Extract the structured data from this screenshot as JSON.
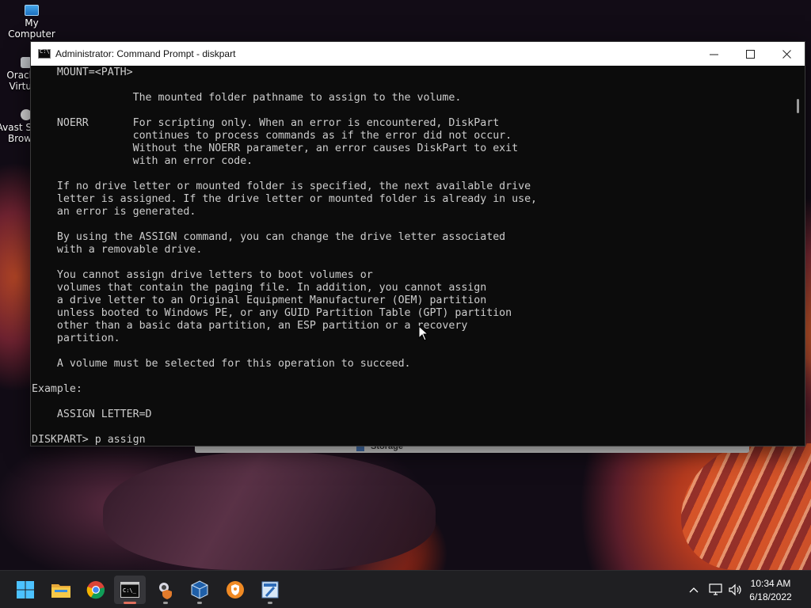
{
  "desktop": {
    "icons": [
      {
        "label": "My Computer",
        "icon": "monitor-icon"
      },
      {
        "label": "Oracl\nVirtu",
        "icon": "virtualbox-icon"
      },
      {
        "label": "Avast S\nBrow",
        "icon": "avast-browser-icon"
      }
    ],
    "behind_window_label": "Storage"
  },
  "window": {
    "title": "Administrator: Command Prompt - diskpart",
    "controls": {
      "minimize": "minimize-icon",
      "maximize": "maximize-icon",
      "close": "close-icon"
    }
  },
  "console": {
    "lines": [
      "    MOUNT=<PATH>",
      "",
      "                The mounted folder pathname to assign to the volume.",
      "",
      "    NOERR       For scripting only. When an error is encountered, DiskPart",
      "                continues to process commands as if the error did not occur.",
      "                Without the NOERR parameter, an error causes DiskPart to exit",
      "                with an error code.",
      "",
      "    If no drive letter or mounted folder is specified, the next available drive",
      "    letter is assigned. If the drive letter or mounted folder is already in use,",
      "    an error is generated.",
      "",
      "    By using the ASSIGN command, you can change the drive letter associated",
      "    with a removable drive.",
      "",
      "    You cannot assign drive letters to boot volumes or",
      "    volumes that contain the paging file. In addition, you cannot assign",
      "    a drive letter to an Original Equipment Manufacturer (OEM) partition",
      "    unless booted to Windows PE, or any GUID Partition Table (GPT) partition",
      "    other than a basic data partition, an ESP partition or a recovery",
      "    partition.",
      "",
      "    A volume must be selected for this operation to succeed.",
      "",
      "Example:",
      "",
      "    ASSIGN LETTER=D",
      "",
      "DISKPART> p assign"
    ]
  },
  "taskbar": {
    "apps": [
      {
        "name": "start",
        "icon": "windows-start-icon",
        "active": false,
        "running": false
      },
      {
        "name": "file-explorer",
        "icon": "folder-icon",
        "active": false,
        "running": false
      },
      {
        "name": "chrome",
        "icon": "chrome-icon",
        "active": false,
        "running": false
      },
      {
        "name": "command-prompt",
        "icon": "terminal-icon",
        "active": true,
        "running": true
      },
      {
        "name": "app-5",
        "icon": "user-shield-icon",
        "active": false,
        "running": true
      },
      {
        "name": "virtualbox",
        "icon": "virtualbox-icon",
        "active": false,
        "running": true
      },
      {
        "name": "avast-browser",
        "icon": "avast-browser-icon",
        "active": false,
        "running": false
      },
      {
        "name": "app-8",
        "icon": "setup-tool-icon",
        "active": false,
        "running": true
      }
    ],
    "tray": {
      "chevron": "chevron-up-icon",
      "network": "network-icon",
      "volume": "volume-icon"
    },
    "clock": {
      "time": "10:34 AM",
      "date": "6/18/2022"
    }
  },
  "colors": {
    "console_bg": "#0c0c0c",
    "console_fg": "#cccccc",
    "taskbar_bg": "#1f1f22",
    "active_indicator": "#e06f5d"
  }
}
